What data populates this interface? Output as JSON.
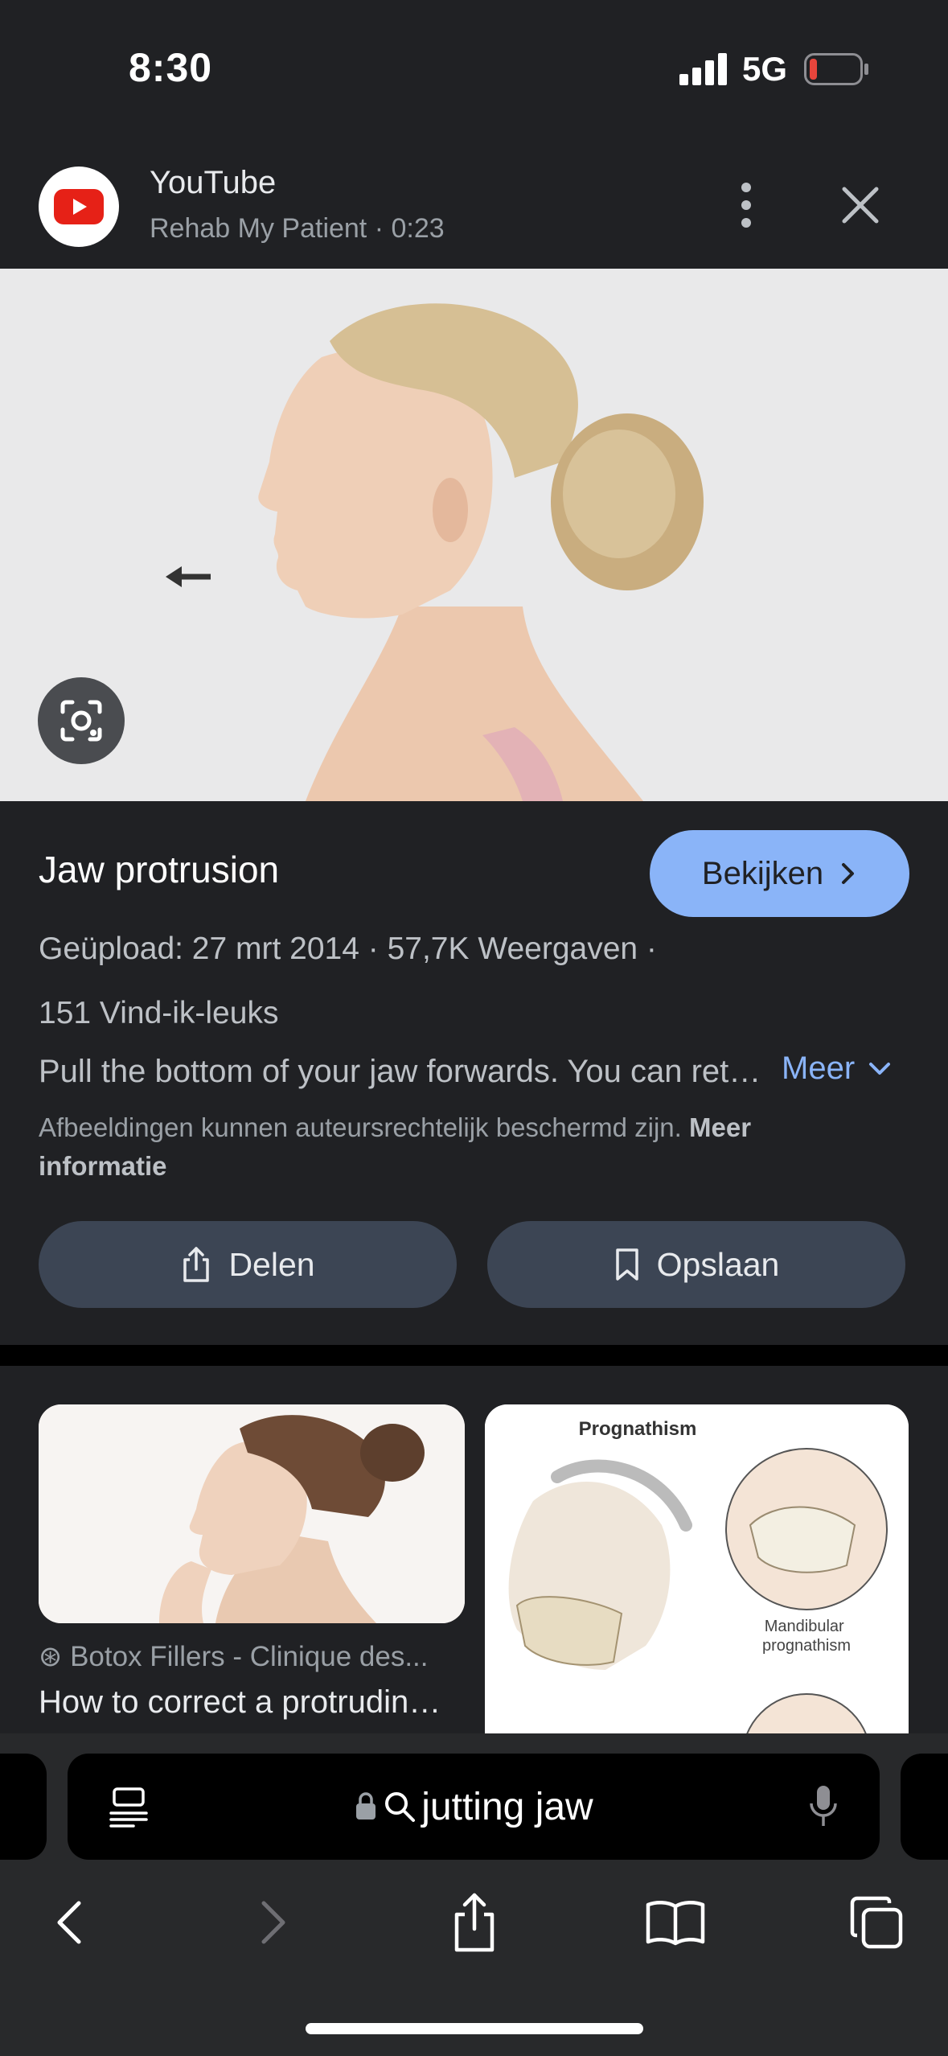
{
  "status_bar": {
    "time": "8:30",
    "network": "5G",
    "battery_color": "#e8453c"
  },
  "source": {
    "name": "YouTube",
    "subtitle": "Rehab My Patient · 0:23"
  },
  "detail": {
    "title": "Jaw protrusion",
    "watch_label": "Bekijken",
    "meta_line1": "Geüpload: 27 mrt 2014  ·  57,7K Weergaven  ·",
    "meta_line2": "151 Vind-ik-leuks",
    "description": "Pull the bottom of your jaw forwards. You can return your jaw to its starting position",
    "more_label": "Meer",
    "copyright_text": "Afbeeldingen kunnen auteursrechtelijk beschermd zijn.",
    "copyright_link": "Meer informatie",
    "share_label": "Delen",
    "save_label": "Opslaan"
  },
  "related": [
    {
      "source": "Botox Fillers - Clinique des...",
      "title": "How to correct a protruding jaw"
    },
    {
      "image_caption_title": "Prognathism",
      "image_caption_sub": "Mandibular prognathism"
    }
  ],
  "address_bar": {
    "query": "jutting jaw"
  },
  "colors": {
    "accent": "#8ab4f8",
    "background": "#202124",
    "button": "#3c4554",
    "youtube_red": "#e62117"
  }
}
